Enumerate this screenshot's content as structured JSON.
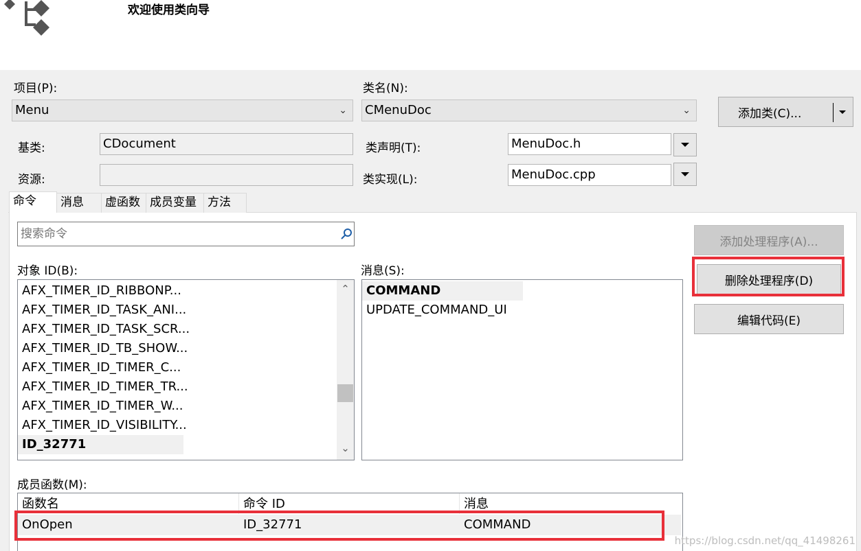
{
  "header": {
    "title": "欢迎使用类向导",
    "logo_icon": "class-hierarchy-icon"
  },
  "project": {
    "label": "项目(P):",
    "value": "Menu"
  },
  "classname": {
    "label": "类名(N):",
    "value": "CMenuDoc"
  },
  "add_class": {
    "label": "添加类(C)..."
  },
  "base_class": {
    "label": "基类:",
    "value": "CDocument"
  },
  "resource": {
    "label": "资源:",
    "value": ""
  },
  "class_decl": {
    "label": "类声明(T):",
    "value": "MenuDoc.h"
  },
  "class_impl": {
    "label": "类实现(L):",
    "value": "MenuDoc.cpp"
  },
  "tabs": [
    {
      "label": "命令",
      "active": true
    },
    {
      "label": "消息"
    },
    {
      "label": "虚函数"
    },
    {
      "label": "成员变量"
    },
    {
      "label": "方法"
    }
  ],
  "search": {
    "placeholder": "搜索命令"
  },
  "object_ids": {
    "label": "对象 ID(B):",
    "items": [
      "AFX_TIMER_ID_RIBBONP...",
      "AFX_TIMER_ID_TASK_ANI...",
      "AFX_TIMER_ID_TASK_SCR...",
      "AFX_TIMER_ID_TB_SHOW...",
      "AFX_TIMER_ID_TIMER_C...",
      "AFX_TIMER_ID_TIMER_TR...",
      "AFX_TIMER_ID_TIMER_W...",
      "AFX_TIMER_ID_VISIBILITY...",
      "ID_32771"
    ],
    "selected": "ID_32771"
  },
  "messages": {
    "label": "消息(S):",
    "items": [
      "COMMAND",
      "UPDATE_COMMAND_UI"
    ],
    "selected": "COMMAND"
  },
  "buttons": {
    "add_handler": "添加处理程序(A)...",
    "delete_handler": "删除处理程序(D)",
    "edit_code": "编辑代码(E)"
  },
  "member_functions": {
    "label": "成员函数(M):",
    "columns": [
      "函数名",
      "命令 ID",
      "消息"
    ],
    "rows": [
      [
        "OnOpen",
        "ID_32771",
        "COMMAND"
      ]
    ]
  },
  "watermark": "https://blog.csdn.net/qq_41498261",
  "colors": {
    "highlight_red": "#e8303a",
    "disabled_button": "#cccccc"
  }
}
